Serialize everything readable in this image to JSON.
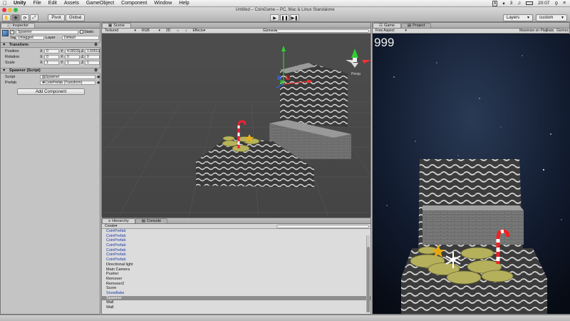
{
  "menubar": {
    "app": "Unity",
    "items": [
      "File",
      "Edit",
      "Assets",
      "GameObject",
      "Component",
      "Window",
      "Help"
    ],
    "status": [
      "A",
      "3",
      "20:07"
    ]
  },
  "window": {
    "title": "Untitled – CoinGame – PC, Mac & Linux Standalone"
  },
  "toolbar": {
    "pivot": "Pivot",
    "global": "Global",
    "layers": "Layers",
    "layout": "custom"
  },
  "inspector": {
    "tab": "Inspector",
    "object_name": "Spawner",
    "static_label": "Static",
    "tag_label": "Tag",
    "tag_value": "Untagged",
    "layer_label": "Layer",
    "layer_value": "Default",
    "transform": {
      "title": "Transform",
      "position_label": "Position",
      "rotation_label": "Rotation",
      "scale_label": "Scale",
      "position": {
        "x": "0",
        "y": "4.08231",
        "z": "1.60012"
      },
      "rotation": {
        "x": "0",
        "y": "0",
        "z": "0"
      },
      "scale": {
        "x": "1",
        "y": "1",
        "z": "1"
      }
    },
    "script_component": {
      "title": "Spawner (Script)",
      "script_label": "Script",
      "script_value": "Spawner",
      "prefab_label": "Prefab",
      "prefab_value": "CoinPrefab (Transform)"
    },
    "add_component": "Add Component"
  },
  "scene": {
    "tab": "Scene",
    "shading": "Textured",
    "render": "RGB",
    "mode_2d": "2D",
    "effects": "Effects",
    "gizmos": "Gizmos",
    "persp": "Persp"
  },
  "game": {
    "tab": "Game",
    "project_tab": "Project",
    "aspect": "Free Aspect",
    "maximize": "Maximize on Play",
    "stats": "Stats",
    "gizmos": "Gizmos",
    "score": "999"
  },
  "hierarchy": {
    "tab": "Hierarchy",
    "console_tab": "Console",
    "create": "Create",
    "items": [
      {
        "name": "CoinPrefab",
        "type": "prefab"
      },
      {
        "name": "CoinPrefab",
        "type": "prefab"
      },
      {
        "name": "CoinPrefab",
        "type": "prefab"
      },
      {
        "name": "CoinPrefab",
        "type": "prefab"
      },
      {
        "name": "CoinPrefab",
        "type": "prefab"
      },
      {
        "name": "CoinPrefab",
        "type": "prefab"
      },
      {
        "name": "CoinPrefab",
        "type": "prefab"
      },
      {
        "name": "Directional light",
        "type": "normal"
      },
      {
        "name": "Main Camera",
        "type": "normal"
      },
      {
        "name": "Pusher",
        "type": "normal"
      },
      {
        "name": "Remover",
        "type": "normal"
      },
      {
        "name": "Remover2",
        "type": "normal"
      },
      {
        "name": "Score",
        "type": "normal"
      },
      {
        "name": "Snowflake",
        "type": "prefab"
      },
      {
        "name": "Spawner",
        "type": "selected"
      },
      {
        "name": "Wall",
        "type": "normal"
      },
      {
        "name": "Wall",
        "type": "normal"
      }
    ]
  },
  "colors": {
    "prefab_text": "#1f3aa6",
    "selected_row": "#8d8d8d",
    "scene_bg": "#4a4a4a",
    "game_bg": "#0b1220"
  }
}
